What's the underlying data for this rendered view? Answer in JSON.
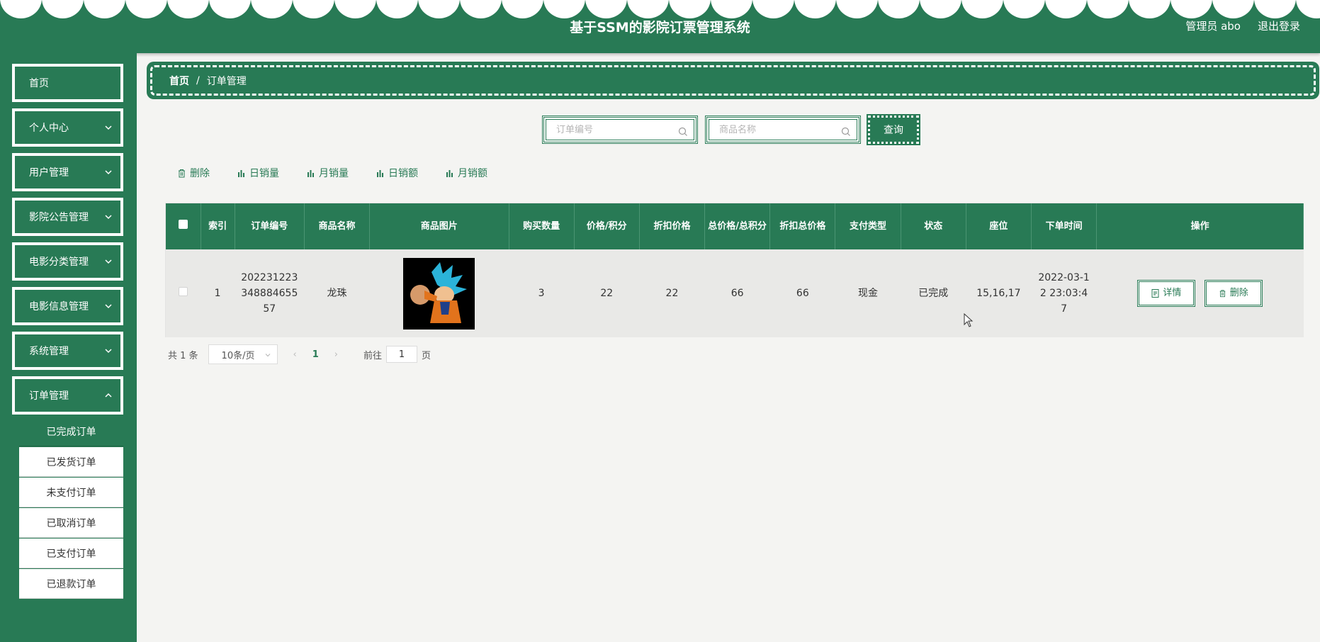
{
  "header": {
    "title": "基于SSM的影院订票管理系统",
    "user": "管理员 abo",
    "logout": "退出登录"
  },
  "sidebar": {
    "items": [
      {
        "label": "首页",
        "expandable": false
      },
      {
        "label": "个人中心",
        "expandable": true
      },
      {
        "label": "用户管理",
        "expandable": true
      },
      {
        "label": "影院公告管理",
        "expandable": true
      },
      {
        "label": "电影分类管理",
        "expandable": true
      },
      {
        "label": "电影信息管理",
        "expandable": true
      },
      {
        "label": "系统管理",
        "expandable": true
      },
      {
        "label": "订单管理",
        "expandable": true
      }
    ],
    "submenu": [
      {
        "label": "已完成订单",
        "active": true
      },
      {
        "label": "已发货订单"
      },
      {
        "label": "未支付订单"
      },
      {
        "label": "已取消订单"
      },
      {
        "label": "已支付订单"
      },
      {
        "label": "已退款订单"
      }
    ]
  },
  "breadcrumb": {
    "home": "首页",
    "separator": "/",
    "current": "订单管理"
  },
  "search": {
    "order_no_placeholder": "订单编号",
    "product_placeholder": "商品名称",
    "query_label": "查询"
  },
  "toolbar": {
    "delete": "删除",
    "daily_sales_volume": "日销量",
    "monthly_sales_volume": "月销量",
    "daily_sales_amount": "日销额",
    "monthly_sales_amount": "月销额"
  },
  "table": {
    "columns": [
      "索引",
      "订单编号",
      "商品名称",
      "商品图片",
      "购买数量",
      "价格/积分",
      "折扣价格",
      "总价格/总积分",
      "折扣总价格",
      "支付类型",
      "状态",
      "座位",
      "下单时间",
      "操作"
    ],
    "rows": [
      {
        "index": "1",
        "order_no": "20223122334888465557",
        "product": "龙珠",
        "quantity": "3",
        "price": "22",
        "discount_price": "22",
        "total": "66",
        "discount_total": "66",
        "pay_type": "现金",
        "status": "已完成",
        "seats": "15,16,17",
        "order_time": "2022-03-12 23:03:47",
        "detail_label": "详情",
        "delete_label": "删除"
      }
    ]
  },
  "pagination": {
    "total": "共 1 条",
    "page_size": "10条/页",
    "current_page": "1",
    "goto_label": "前往",
    "goto_value": "1",
    "goto_suffix": "页"
  },
  "colors": {
    "primary": "#287a55",
    "background": "#f4f4f2"
  }
}
